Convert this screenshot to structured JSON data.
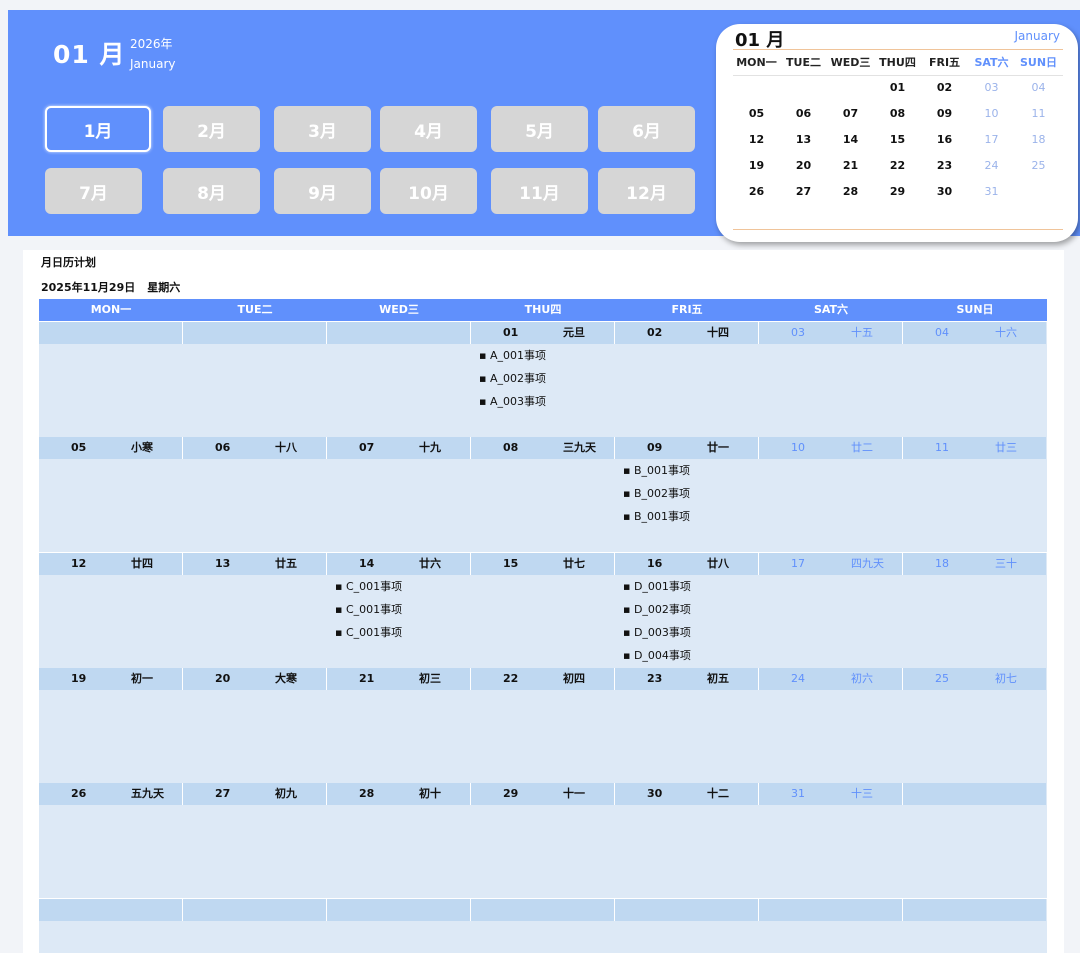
{
  "header": {
    "big_month": "01 月",
    "year": "2026年",
    "month_en": "January",
    "months": [
      "1月",
      "2月",
      "3月",
      "4月",
      "5月",
      "6月",
      "7月",
      "8月",
      "9月",
      "10月",
      "11月",
      "12月"
    ],
    "active_month_index": 0
  },
  "mini_calendar": {
    "title": "01 月",
    "month_en": "January",
    "weekdays": [
      "MON一",
      "TUE二",
      "WED三",
      "THU四",
      "FRI五",
      "SAT六",
      "SUN日"
    ],
    "weeks": [
      [
        "",
        "",
        "",
        "01",
        "02",
        "03",
        "04"
      ],
      [
        "05",
        "06",
        "07",
        "08",
        "09",
        "10",
        "11"
      ],
      [
        "12",
        "13",
        "14",
        "15",
        "16",
        "17",
        "18"
      ],
      [
        "19",
        "20",
        "21",
        "22",
        "23",
        "24",
        "25"
      ],
      [
        "26",
        "27",
        "28",
        "29",
        "30",
        "31",
        ""
      ]
    ]
  },
  "planner": {
    "title": "月日历计划",
    "date": "2025年11月29日",
    "weekday": "星期六",
    "weekdays": [
      "MON一",
      "TUE二",
      "WED三",
      "THU四",
      "FRI五",
      "SAT六",
      "SUN日"
    ],
    "weeks": [
      {
        "days": [
          {
            "num": "",
            "lunar": "",
            "tasks": []
          },
          {
            "num": "",
            "lunar": "",
            "tasks": []
          },
          {
            "num": "",
            "lunar": "",
            "tasks": []
          },
          {
            "num": "01",
            "lunar": "元旦",
            "tasks": [
              "A_001事项",
              "A_002事项",
              "A_003事项"
            ]
          },
          {
            "num": "02",
            "lunar": "十四",
            "tasks": []
          },
          {
            "num": "03",
            "lunar": "十五",
            "tasks": []
          },
          {
            "num": "04",
            "lunar": "十六",
            "tasks": []
          }
        ]
      },
      {
        "days": [
          {
            "num": "05",
            "lunar": "小寒",
            "tasks": []
          },
          {
            "num": "06",
            "lunar": "十八",
            "tasks": []
          },
          {
            "num": "07",
            "lunar": "十九",
            "tasks": []
          },
          {
            "num": "08",
            "lunar": "三九天",
            "tasks": []
          },
          {
            "num": "09",
            "lunar": "廿一",
            "tasks": [
              "B_001事项",
              "B_002事项",
              "B_001事项"
            ]
          },
          {
            "num": "10",
            "lunar": "廿二",
            "tasks": []
          },
          {
            "num": "11",
            "lunar": "廿三",
            "tasks": []
          }
        ]
      },
      {
        "days": [
          {
            "num": "12",
            "lunar": "廿四",
            "tasks": []
          },
          {
            "num": "13",
            "lunar": "廿五",
            "tasks": []
          },
          {
            "num": "14",
            "lunar": "廿六",
            "tasks": [
              "C_001事项",
              "C_001事项",
              "C_001事项"
            ]
          },
          {
            "num": "15",
            "lunar": "廿七",
            "tasks": []
          },
          {
            "num": "16",
            "lunar": "廿八",
            "tasks": [
              "D_001事项",
              "D_002事项",
              "D_003事项",
              "D_004事项"
            ]
          },
          {
            "num": "17",
            "lunar": "四九天",
            "tasks": []
          },
          {
            "num": "18",
            "lunar": "三十",
            "tasks": []
          }
        ]
      },
      {
        "days": [
          {
            "num": "19",
            "lunar": "初一",
            "tasks": []
          },
          {
            "num": "20",
            "lunar": "大寒",
            "tasks": []
          },
          {
            "num": "21",
            "lunar": "初三",
            "tasks": []
          },
          {
            "num": "22",
            "lunar": "初四",
            "tasks": []
          },
          {
            "num": "23",
            "lunar": "初五",
            "tasks": []
          },
          {
            "num": "24",
            "lunar": "初六",
            "tasks": []
          },
          {
            "num": "25",
            "lunar": "初七",
            "tasks": []
          }
        ]
      },
      {
        "days": [
          {
            "num": "26",
            "lunar": "五九天",
            "tasks": []
          },
          {
            "num": "27",
            "lunar": "初九",
            "tasks": []
          },
          {
            "num": "28",
            "lunar": "初十",
            "tasks": []
          },
          {
            "num": "29",
            "lunar": "十一",
            "tasks": []
          },
          {
            "num": "30",
            "lunar": "十二",
            "tasks": []
          },
          {
            "num": "31",
            "lunar": "十三",
            "tasks": []
          },
          {
            "num": "",
            "lunar": "",
            "tasks": []
          }
        ]
      },
      {
        "days": [
          {
            "num": "",
            "lunar": "",
            "tasks": []
          },
          {
            "num": "",
            "lunar": "",
            "tasks": []
          },
          {
            "num": "",
            "lunar": "",
            "tasks": []
          },
          {
            "num": "",
            "lunar": "",
            "tasks": []
          },
          {
            "num": "",
            "lunar": "",
            "tasks": []
          },
          {
            "num": "",
            "lunar": "",
            "tasks": []
          },
          {
            "num": "",
            "lunar": "",
            "tasks": []
          }
        ]
      }
    ]
  },
  "colors": {
    "accent": "#6090fc",
    "weekend_text": "#6090fc",
    "day_header_bg": "#bfd8f1",
    "cell_bg": "#dde9f6",
    "button_bg": "#d6d6d6"
  }
}
